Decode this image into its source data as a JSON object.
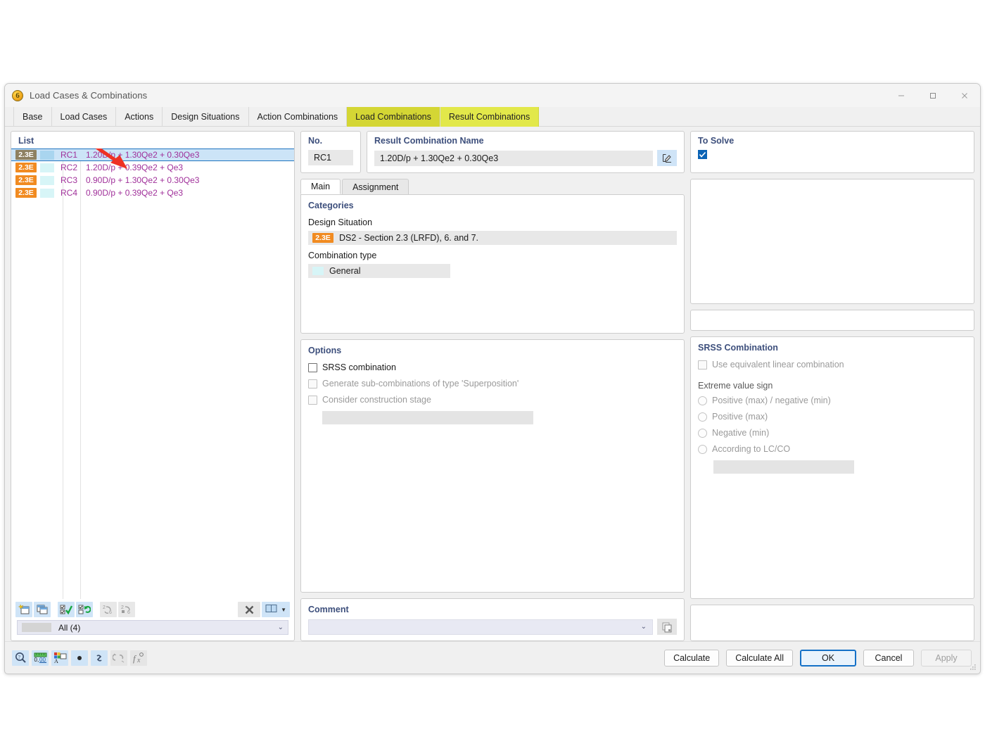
{
  "window": {
    "title": "Load Cases & Combinations",
    "icon": "app-dlubal-icon",
    "controls": {
      "minimize": "minimize-icon",
      "maximize": "maximize-icon",
      "close": "close-icon"
    }
  },
  "tabs": [
    {
      "label": "Base",
      "state": "normal"
    },
    {
      "label": "Load Cases",
      "state": "normal"
    },
    {
      "label": "Actions",
      "state": "normal"
    },
    {
      "label": "Design Situations",
      "state": "normal"
    },
    {
      "label": "Action Combinations",
      "state": "normal"
    },
    {
      "label": "Load Combinations",
      "state": "highlight-olive"
    },
    {
      "label": "Result Combinations",
      "state": "highlight-yellow"
    }
  ],
  "list": {
    "title": "List",
    "rows": [
      {
        "badge": "2.3E",
        "no": "RC1",
        "name": "1.20D/p + 1.30Qe2 + 0.30Qe3",
        "selected": true
      },
      {
        "badge": "2.3E",
        "no": "RC2",
        "name": "1.20D/p + 0.39Qe2 + Qe3",
        "selected": false
      },
      {
        "badge": "2.3E",
        "no": "RC3",
        "name": "0.90D/p + 1.30Qe2 + 0.30Qe3",
        "selected": false
      },
      {
        "badge": "2.3E",
        "no": "RC4",
        "name": "0.90D/p + 0.39Qe2 + Qe3",
        "selected": false
      }
    ],
    "toolbar": [
      {
        "name": "new-combination-icon",
        "enabled": true
      },
      {
        "name": "copy-combination-icon",
        "enabled": true
      },
      {
        "name": "select-all-icon",
        "enabled": true
      },
      {
        "name": "invert-selection-icon",
        "enabled": true
      },
      {
        "name": "renumber-icon",
        "enabled": false
      },
      {
        "name": "renumber-fixed-icon",
        "enabled": false
      },
      {
        "name": "delete-icon",
        "enabled": true
      },
      {
        "name": "view-columns-icon",
        "enabled": true
      }
    ],
    "filter": {
      "label": "All (4)",
      "chevron": "chevron-down-icon"
    }
  },
  "details": {
    "no": {
      "label": "No.",
      "value": "RC1"
    },
    "name": {
      "label": "Result Combination Name",
      "value": "1.20D/p + 1.30Qe2 + 0.30Qe3",
      "edit_icon": "edit-pencil-icon"
    },
    "to_solve": {
      "label": "To Solve",
      "checked": true,
      "check_icon": "checkmark-icon"
    },
    "inner_tabs": [
      {
        "label": "Main",
        "active": true
      },
      {
        "label": "Assignment",
        "active": false
      }
    ],
    "categories": {
      "title": "Categories",
      "design_situation_label": "Design Situation",
      "design_situation_badge": "2.3E",
      "design_situation_value": "DS2 - Section 2.3 (LRFD), 6. and 7.",
      "combination_type_label": "Combination type",
      "combination_type_value": "General"
    },
    "options": {
      "title": "Options",
      "items": [
        {
          "label": "SRSS combination",
          "checked": false,
          "enabled": true
        },
        {
          "label": "Generate sub-combinations of type 'Superposition'",
          "checked": false,
          "enabled": false
        },
        {
          "label": "Consider construction stage",
          "checked": false,
          "enabled": false
        }
      ]
    },
    "srss": {
      "title": "SRSS Combination",
      "use_equivalent": {
        "label": "Use equivalent linear combination",
        "checked": false,
        "enabled": false
      },
      "extreme_value_label": "Extreme value sign",
      "extreme_value_options": [
        {
          "label": "Positive (max) / negative (min)",
          "selected": false
        },
        {
          "label": "Positive (max)",
          "selected": false
        },
        {
          "label": "Negative (min)",
          "selected": false
        },
        {
          "label": "According to LC/CO",
          "selected": false
        }
      ]
    },
    "comment": {
      "title": "Comment",
      "value": "",
      "chevron": "chevron-down-icon",
      "copy_icon": "copy-icon"
    }
  },
  "footer": {
    "tools": [
      {
        "name": "help-search-icon",
        "enabled": true
      },
      {
        "name": "units-decimal-icon",
        "enabled": true
      },
      {
        "name": "color-legend-icon",
        "enabled": true
      },
      {
        "name": "dot-icon",
        "enabled": true
      },
      {
        "name": "link-icon",
        "enabled": true
      },
      {
        "name": "relations-icon",
        "enabled": false
      },
      {
        "name": "formula-icon",
        "enabled": false
      }
    ],
    "buttons": [
      {
        "label": "Calculate",
        "style": "normal"
      },
      {
        "label": "Calculate All",
        "style": "normal"
      },
      {
        "label": "OK",
        "style": "primary"
      },
      {
        "label": "Cancel",
        "style": "normal"
      },
      {
        "label": "Apply",
        "style": "disabled"
      }
    ]
  },
  "annotation": {
    "arrow": "red-arrow-pointer",
    "color": "#ee3124"
  }
}
